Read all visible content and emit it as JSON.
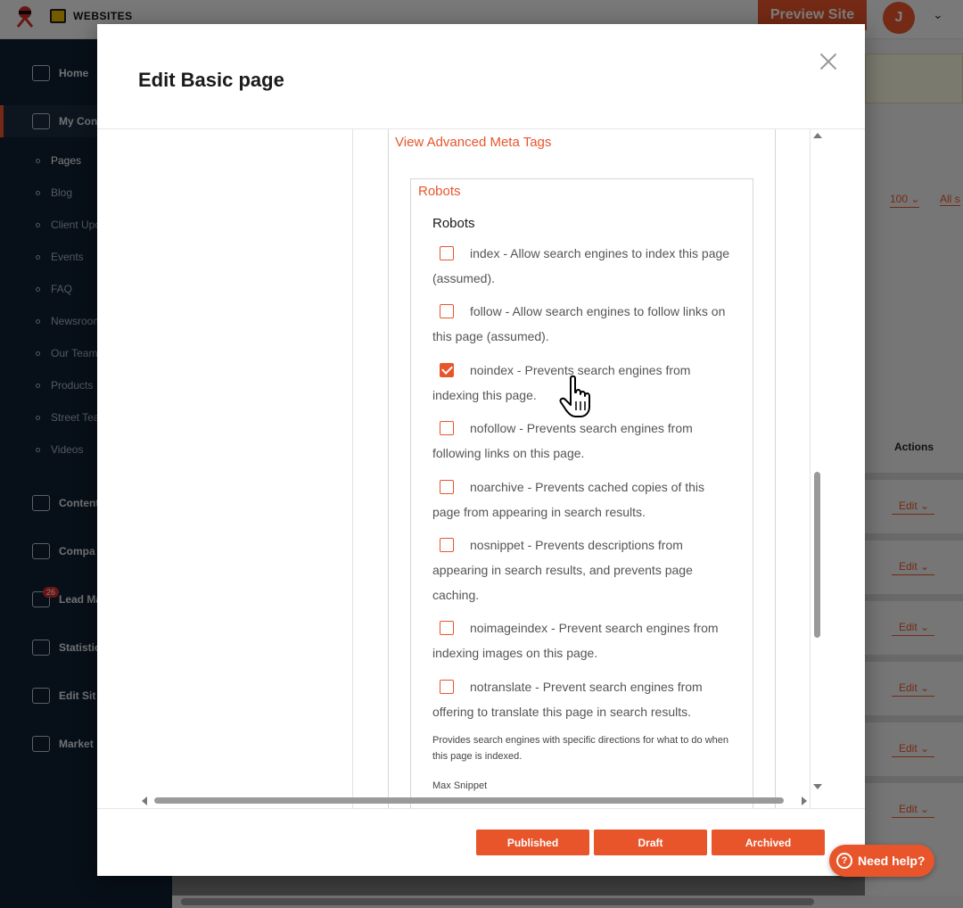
{
  "app": {
    "brand": "WEBSITES",
    "preview_label": "Preview Site",
    "avatar_initial": "J"
  },
  "sidebar": {
    "items": [
      {
        "label": "Home"
      },
      {
        "label": "My Con"
      },
      {
        "label": "Content"
      },
      {
        "label": "Compa"
      },
      {
        "label": "Lead Ma"
      },
      {
        "label": "Statistic"
      },
      {
        "label": "Edit Sit"
      },
      {
        "label": "Market"
      }
    ],
    "sub_items": [
      "Pages",
      "Blog",
      "Client Upc",
      "Events",
      "FAQ",
      "Newsroom",
      "Our Team",
      "Products",
      "Street Tea",
      "Videos"
    ],
    "lead_badge": "26"
  },
  "background_table": {
    "per_page": "100",
    "filter": "All s",
    "actions_header": "Actions",
    "edit_label": "Edit"
  },
  "modal": {
    "title": "Edit Basic page",
    "advanced_meta_link": "View Advanced Meta Tags",
    "robots_link": "Robots",
    "robots_label": "Robots",
    "options": [
      {
        "text": "index - Allow search engines to index this page (assumed).",
        "checked": false
      },
      {
        "text": "follow - Allow search engines to follow links on this page (assumed).",
        "checked": false
      },
      {
        "text": "noindex - Prevents search engines from indexing this page.",
        "checked": true
      },
      {
        "text": "nofollow - Prevents search engines from following links on this page.",
        "checked": false
      },
      {
        "text": "noarchive - Prevents cached copies of this page from appearing in search results.",
        "checked": false
      },
      {
        "text": "nosnippet - Prevents descriptions from appearing in search results, and prevents page caching.",
        "checked": false
      },
      {
        "text": "noimageindex - Prevent search engines from indexing images on this page.",
        "checked": false
      },
      {
        "text": "notranslate - Prevent search engines from offering to translate this page in search results.",
        "checked": false
      }
    ],
    "help_text": "Provides search engines with specific directions for what to do when this page is indexed.",
    "max_snippet_label": "Max Snippet",
    "buttons": {
      "published": "Published",
      "draft": "Draft",
      "archived": "Archived"
    }
  },
  "help_widget": {
    "label": "Need help?"
  },
  "colors": {
    "accent": "#e8552b",
    "sidebar_bg": "#0f1e30"
  }
}
